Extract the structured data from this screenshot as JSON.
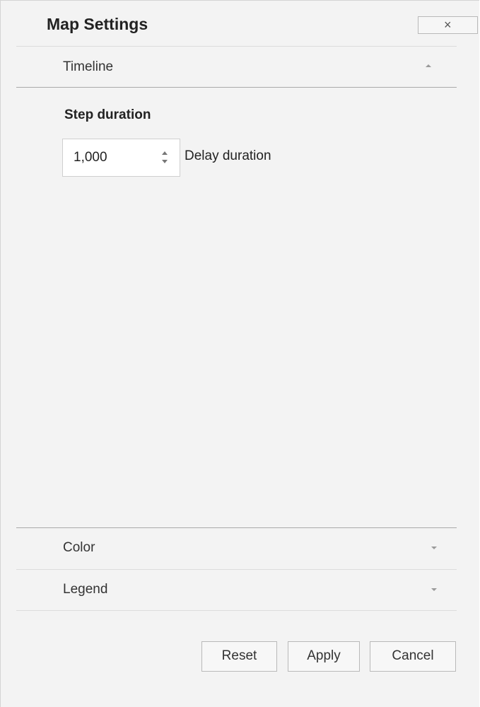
{
  "dialog": {
    "title": "Map Settings",
    "close_label": "×"
  },
  "sections": {
    "timeline": {
      "label": "Timeline",
      "expanded": true
    },
    "color": {
      "label": "Color",
      "expanded": false
    },
    "legend": {
      "label": "Legend",
      "expanded": false
    }
  },
  "timeline": {
    "step_duration_label": "Step duration",
    "step_duration_value": "1,000",
    "delay_label": "Delay duration"
  },
  "buttons": {
    "reset": "Reset",
    "apply": "Apply",
    "cancel": "Cancel"
  },
  "icons": {
    "close": "close-icon",
    "expand": "chevron-up-icon",
    "collapse": "chevron-down-icon",
    "spinner": "spinner-arrows-icon"
  }
}
